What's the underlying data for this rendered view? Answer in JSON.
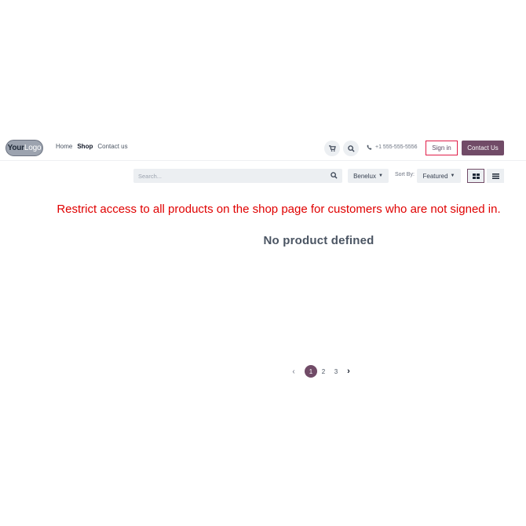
{
  "header": {
    "logo_text_a": "Your",
    "logo_text_b": "Logo",
    "nav": [
      "Home",
      "Shop",
      "Contact us"
    ],
    "phone": "+1 555-555-5556",
    "signin": "Sign in",
    "contact": "Contact Us"
  },
  "toolbar": {
    "search_placeholder": "Search...",
    "pricelist": "Benelux",
    "sort_label": "Sort By:",
    "sort_value": "Featured"
  },
  "content": {
    "annotation": "Restrict access to all products on the shop page for customers who are not signed in.",
    "empty_message": "No product defined"
  },
  "pager": {
    "pages": [
      "1",
      "2",
      "3"
    ],
    "current": "1"
  },
  "colors": {
    "brand": "#714b67",
    "annotation": "#e00000",
    "signin_border": "#e11d48"
  }
}
